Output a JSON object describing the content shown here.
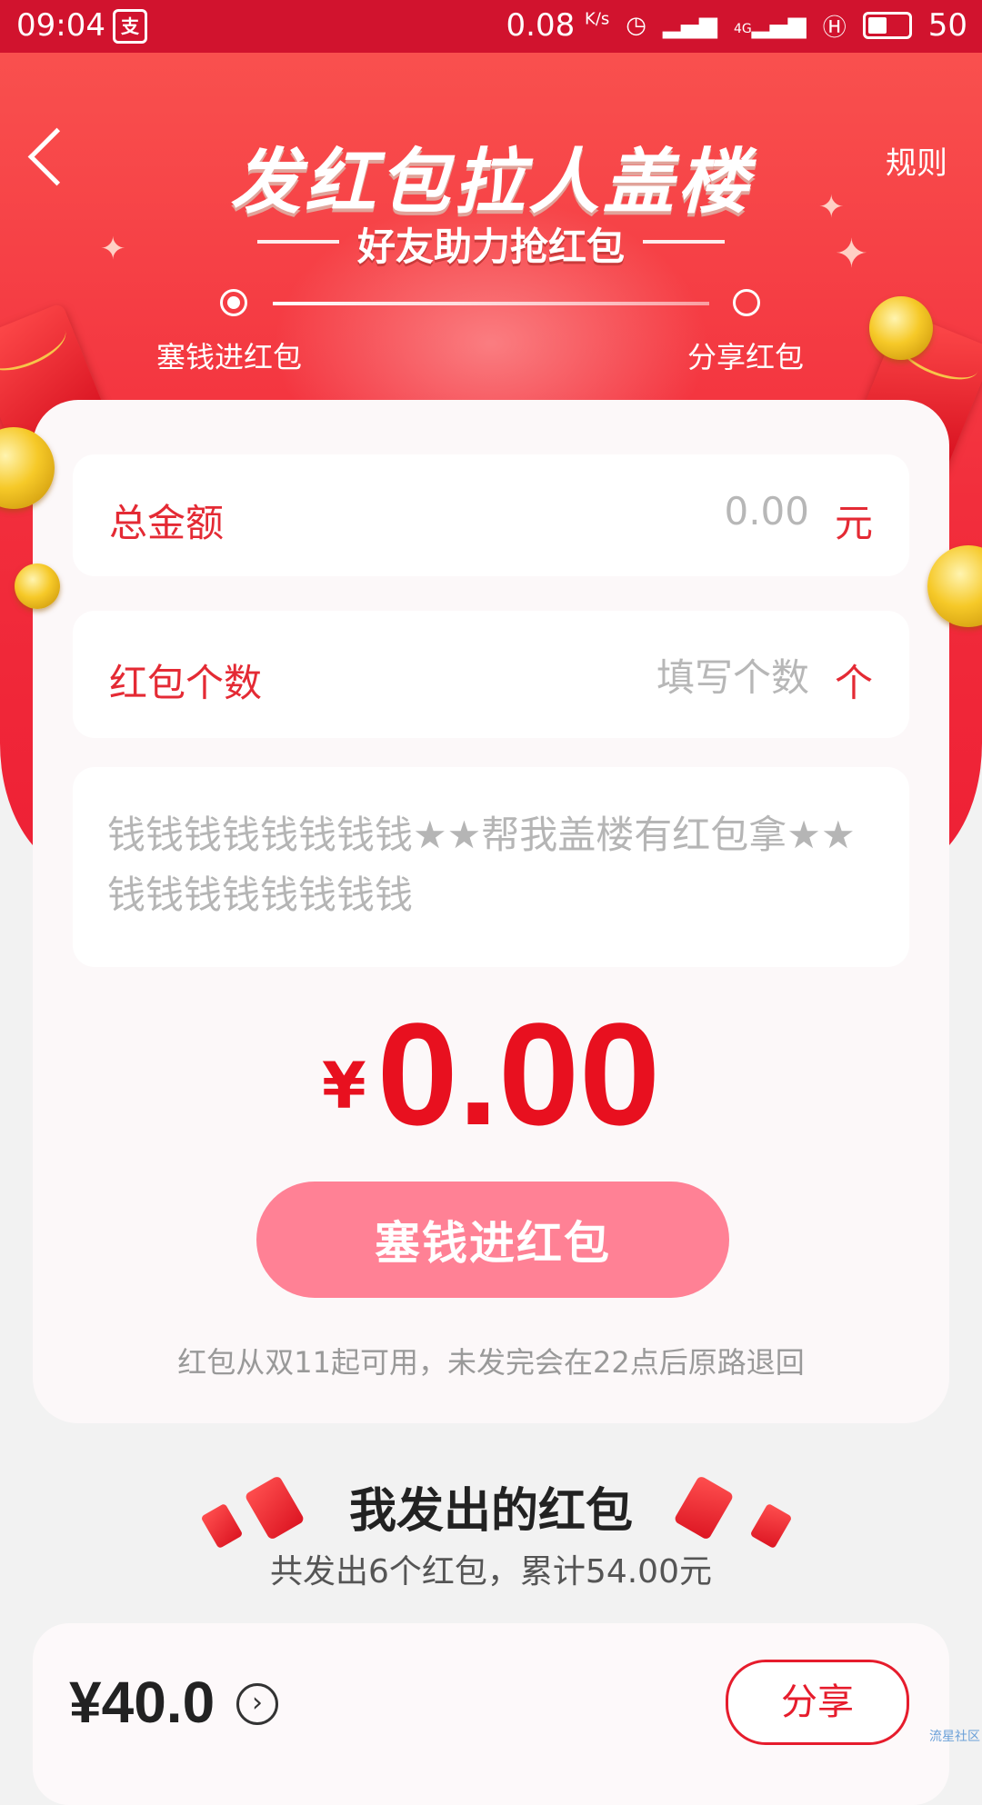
{
  "status_bar": {
    "time": "09:04",
    "app_icon": "支",
    "speed": "0.08",
    "speed_unit": "K/s",
    "network": "4G",
    "battery": "50"
  },
  "header": {
    "back_icon": "chevron-left-icon",
    "title": "发红包拉人盖楼",
    "subtitle": "好友助力抢红包",
    "rules_label": "规则",
    "steps": [
      {
        "label": "塞钱进红包",
        "active": true
      },
      {
        "label": "分享红包",
        "active": false
      }
    ]
  },
  "form": {
    "total_label": "总金额",
    "total_value": "0.00",
    "total_unit": "元",
    "count_label": "红包个数",
    "count_placeholder": "填写个数",
    "count_unit": "个",
    "message": "钱钱钱钱钱钱钱钱★★帮我盖楼有红包拿★★钱钱钱钱钱钱钱钱",
    "currency": "¥",
    "amount": "0.00",
    "submit_label": "塞钱进红包",
    "hint": "红包从双11起可用，未发完会在22点后原路退回"
  },
  "sent": {
    "title": "我发出的红包",
    "summary": "共发出6个红包，累计54.00元",
    "records": [
      {
        "amount": "¥40.0",
        "share_label": "分享"
      }
    ]
  },
  "watermark": "流星社区",
  "colors": {
    "brand_red": "#e8101f",
    "button_pink": "#ff8195",
    "header_red": "#f22e3c"
  }
}
